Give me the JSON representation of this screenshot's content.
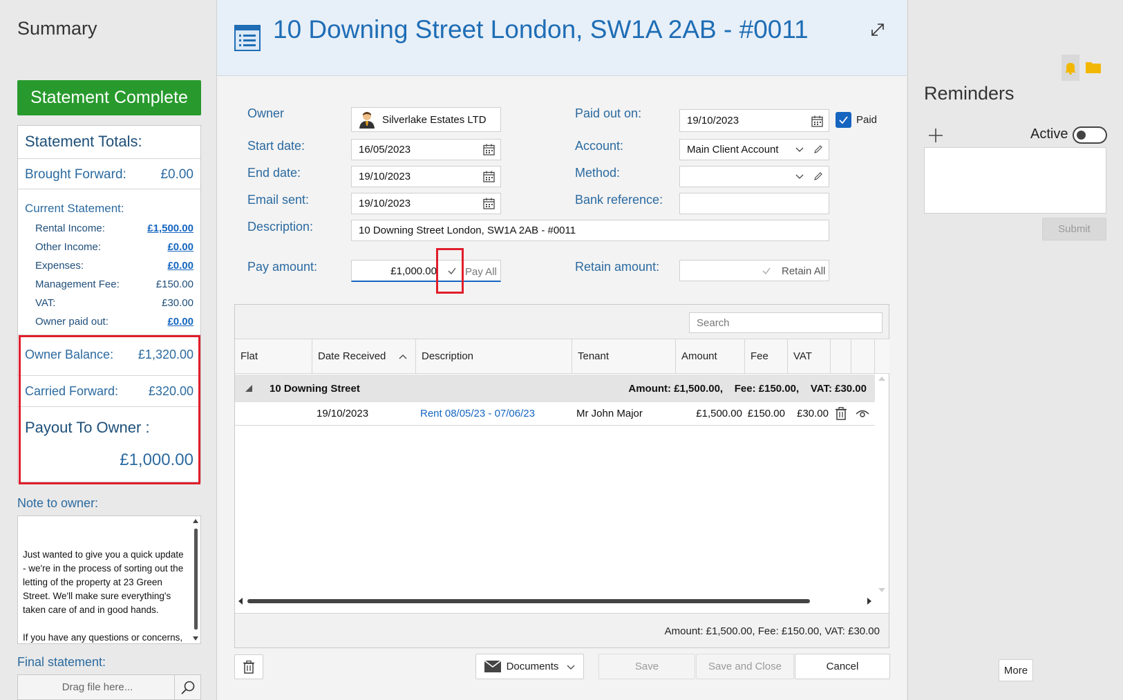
{
  "summary": {
    "title": "Summary",
    "status_button": "Statement Complete",
    "totals_heading": "Statement Totals:",
    "brought_forward": {
      "label": "Brought Forward:",
      "value": "£0.00"
    },
    "current_statement_label": "Current Statement:",
    "lines": [
      {
        "label": "Rental Income:",
        "value": "£1,500.00",
        "link": true
      },
      {
        "label": "Other Income:",
        "value": "£0.00",
        "link": true
      },
      {
        "label": "Expenses:",
        "value": "£0.00",
        "link": true
      },
      {
        "label": "Management Fee:",
        "value": "£150.00",
        "link": false
      },
      {
        "label": "VAT:",
        "value": "£30.00",
        "link": false
      },
      {
        "label": "Owner paid out:",
        "value": "£0.00",
        "link": true
      }
    ],
    "owner_balance": {
      "label": "Owner Balance:",
      "value": "£1,320.00"
    },
    "carried_forward": {
      "label": "Carried Forward:",
      "value": "£320.00"
    },
    "payout": {
      "label": "Payout To Owner :",
      "value": "£1,000.00"
    },
    "note_label": "Note to owner:",
    "note_text": "Just wanted to give you a quick update - we're in the process of sorting out the letting of the property at 23 Green Street. We'll make sure everything's taken care of and in good hands.\n\nIf you have any questions or concerns, feel free to give us a",
    "final_statement_label": "Final statement:",
    "drop_placeholder": "Drag file here..."
  },
  "header": {
    "title": "10 Downing Street London, SW1A 2AB - #0011"
  },
  "form": {
    "owner": {
      "label": "Owner",
      "value": "Silverlake Estates LTD"
    },
    "start_date": {
      "label": "Start date:",
      "value": "16/05/2023"
    },
    "end_date": {
      "label": "End date:",
      "value": "19/10/2023"
    },
    "email_sent": {
      "label": "Email sent:",
      "value": "19/10/2023"
    },
    "description": {
      "label": "Description:",
      "value": "10 Downing Street London, SW1A 2AB - #0011"
    },
    "pay_amount": {
      "label": "Pay amount:",
      "value": "£1,000.00",
      "pay_all": "Pay All"
    },
    "paid_out_on": {
      "label": "Paid out on:",
      "value": "19/10/2023"
    },
    "paid": {
      "label": "Paid",
      "checked": true
    },
    "account": {
      "label": "Account:",
      "value": "Main Client Account"
    },
    "method": {
      "label": "Method:",
      "value": ""
    },
    "bank_reference": {
      "label": "Bank reference:",
      "value": ""
    },
    "retain_amount": {
      "label": "Retain amount:",
      "value": "",
      "retain_all": "Retain All"
    }
  },
  "grid": {
    "search_placeholder": "Search",
    "columns": [
      "Flat",
      "Date Received",
      "Description",
      "Tenant",
      "Amount",
      "Fee",
      "VAT"
    ],
    "group": {
      "name": "10 Downing Street",
      "summary": "Amount: £1,500.00,    Fee: £150.00,    VAT: £30.00"
    },
    "rows": [
      {
        "flat": "",
        "date": "19/10/2023",
        "description": "Rent 08/05/23 - 07/06/23",
        "tenant": "Mr John Major",
        "amount": "£1,500.00",
        "fee": "£150.00",
        "vat": "£30.00"
      }
    ],
    "footer": "Amount: £1,500.00, Fee: £150.00, VAT: £30.00"
  },
  "actions": {
    "documents": "Documents",
    "save": "Save",
    "save_close": "Save and Close",
    "cancel": "Cancel"
  },
  "reminders": {
    "title": "Reminders",
    "active_label": "Active",
    "submit": "Submit",
    "more": "More"
  },
  "colors": {
    "accent": "#1e6db5",
    "complete_green": "#289a2d",
    "highlight_red": "#e01e2b"
  }
}
